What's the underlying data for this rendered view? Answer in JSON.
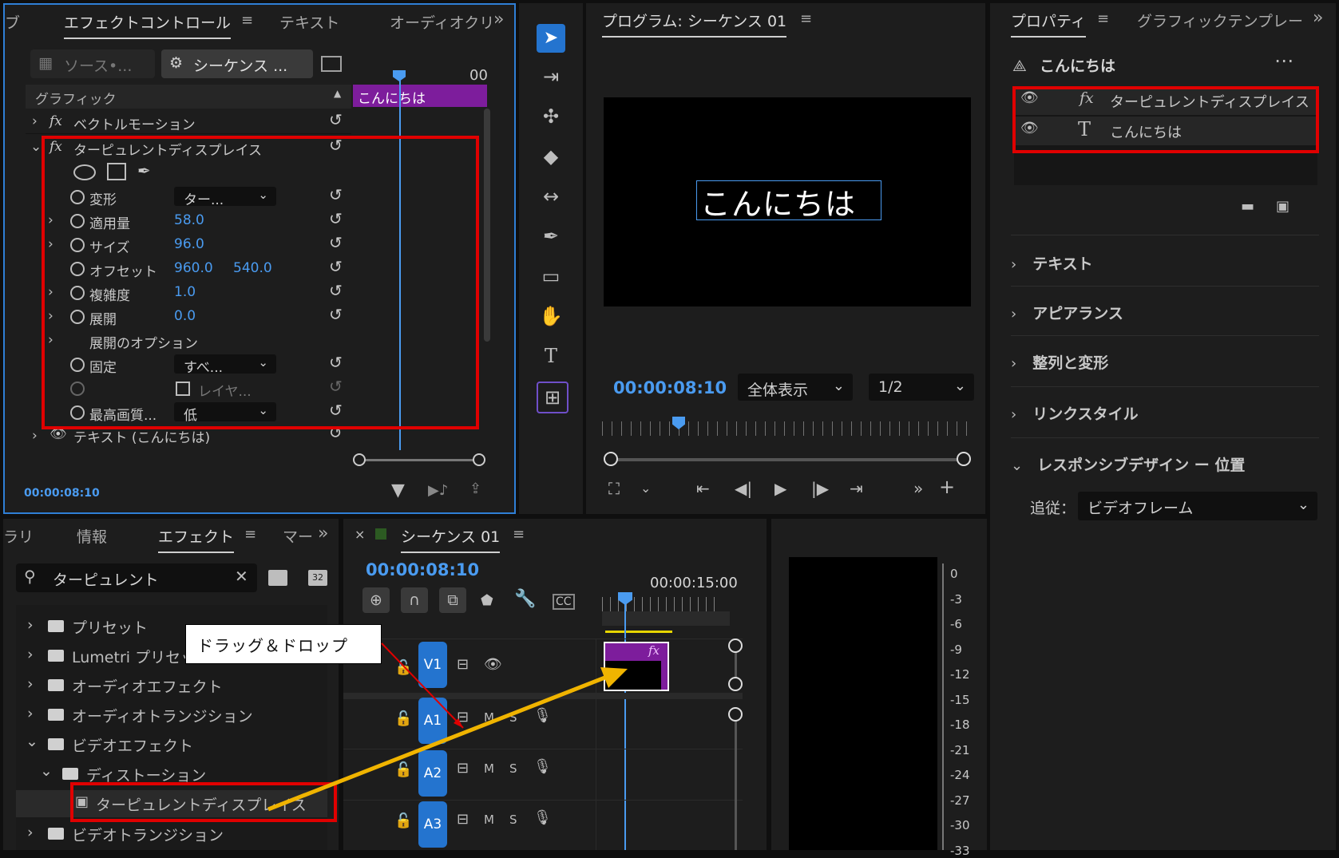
{
  "effect_controls": {
    "tabs": [
      "エフェクトコントロール",
      "テキスト",
      "オーディオクリ"
    ],
    "source_label": "ソース•...",
    "sequence_label": "シーケンス ...",
    "clip_name": "こんにちは",
    "timeline_tick": "00",
    "section": "グラフィック",
    "vector_motion": "ベクトルモーション",
    "effect_name": "ターピュレントディスプレイス",
    "props": {
      "transform": {
        "label": "変形",
        "value": "ター..."
      },
      "amount": {
        "label": "適用量",
        "value": "58.0"
      },
      "size": {
        "label": "サイズ",
        "value": "96.0"
      },
      "offset": {
        "label": "オフセット",
        "x": "960.0",
        "y": "540.0"
      },
      "complexity": {
        "label": "複雑度",
        "value": "1.0"
      },
      "evolution": {
        "label": "展開",
        "value": "0.0"
      },
      "evolution_options": {
        "label": "展開のオプション"
      },
      "pinning": {
        "label": "固定",
        "value": "すべ..."
      },
      "layer": {
        "label": "レイヤ..."
      },
      "quality": {
        "label": "最高画質...",
        "value": "低"
      }
    },
    "text_layer": "テキスト (こんにちは)",
    "timecode": "00:00:08:10"
  },
  "tools": [
    "selection-tool",
    "track-select-tool",
    "ripple-edit-tool",
    "razor-tool",
    "slip-tool",
    "pen-tool",
    "rectangle-tool",
    "hand-tool",
    "type-tool",
    "vertical-type-tool"
  ],
  "program": {
    "title": "プログラム: シーケンス 01",
    "preview_text": "こんにちは",
    "timecode": "00:00:08:10",
    "zoom": "全体表示",
    "resolution": "1/2"
  },
  "properties": {
    "tabs": [
      "プロパティ",
      "グラフィックテンプレー"
    ],
    "clip_name": "こんにちは",
    "layers": [
      {
        "icon": "fx",
        "name": "ターピュレントディスプレイス"
      },
      {
        "icon": "T",
        "name": "こんにちは"
      }
    ],
    "sections": [
      "テキスト",
      "アピアランス",
      "整列と変形",
      "リンクスタイル",
      "レスポンシブデザイン ー 位置"
    ],
    "follow_label": "追従：",
    "follow_value": "ビデオフレーム"
  },
  "effects_panel": {
    "tabs": [
      "ラリ",
      "情報",
      "エフェクト",
      "マー"
    ],
    "search_value": "ターピュレント",
    "tree": [
      {
        "label": "プリセット",
        "level": 0,
        "open": false
      },
      {
        "label": "Lumetri プリセット",
        "level": 0,
        "open": false
      },
      {
        "label": "オーディオエフェクト",
        "level": 0,
        "open": false
      },
      {
        "label": "オーディオトランジション",
        "level": 0,
        "open": false
      },
      {
        "label": "ビデオエフェクト",
        "level": 0,
        "open": true
      },
      {
        "label": "ディストーション",
        "level": 1,
        "open": true
      },
      {
        "label": "ターピュレントディスプレイス",
        "level": 2,
        "open": false
      },
      {
        "label": "ビデオトランジション",
        "level": 0,
        "open": false
      }
    ]
  },
  "timeline": {
    "title": "シーケンス 01",
    "timecode": "00:00:08:10",
    "ruler_label": "00:00:15:00",
    "tracks": [
      {
        "name": "V1"
      },
      {
        "name": "A1"
      },
      {
        "name": "A2"
      },
      {
        "name": "A3"
      }
    ],
    "track_letters": {
      "m": "M",
      "s": "S"
    }
  },
  "meter": {
    "labels": [
      "0",
      "-3",
      "-6",
      "-9",
      "-12",
      "-15",
      "-18",
      "-21",
      "-24",
      "-27",
      "-30",
      "-33"
    ]
  },
  "annotation": {
    "callout": "ドラッグ＆ドロップ"
  },
  "colors": {
    "accent_blue": "#2474cf",
    "timecode_blue": "#4a9bf0",
    "highlight_red": "#e00000",
    "clip_purple": "#7d1d9c",
    "arrow_yellow": "#f0b400"
  }
}
